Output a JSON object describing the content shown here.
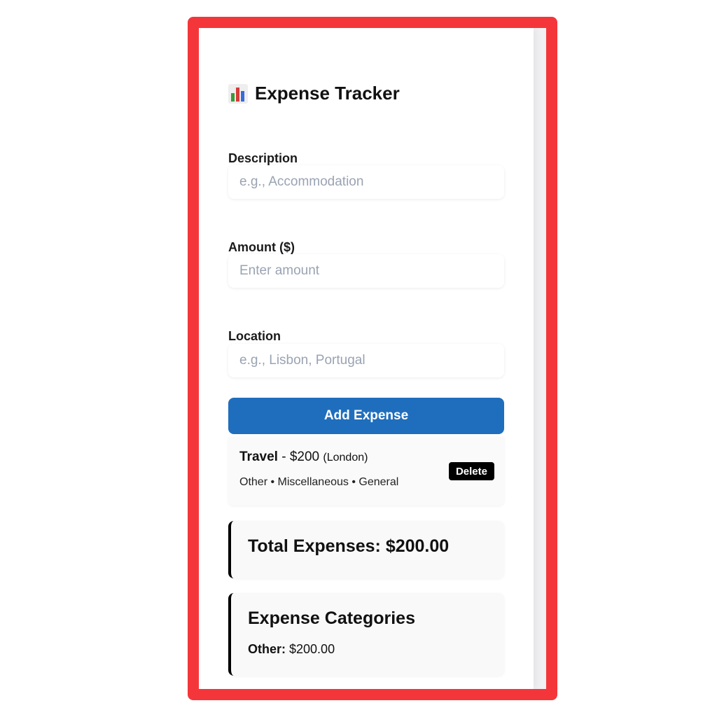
{
  "app": {
    "title": "Expense Tracker",
    "title_icon": "bar-chart-icon"
  },
  "form": {
    "description": {
      "label": "Description",
      "placeholder": "e.g., Accommodation",
      "value": ""
    },
    "amount": {
      "label": "Amount ($)",
      "placeholder": "Enter amount",
      "value": ""
    },
    "location": {
      "label": "Location",
      "placeholder": "e.g., Lisbon, Portugal",
      "value": ""
    },
    "submit_label": "Add Expense"
  },
  "expenses": [
    {
      "name": "Travel",
      "separator": " - ",
      "amount": "$200",
      "location": "(London)",
      "tags": "Other • Miscellaneous • General",
      "delete_label": "Delete"
    }
  ],
  "summary": {
    "total_label": "Total Expenses: $200.00",
    "categories_title": "Expense Categories",
    "categories": [
      {
        "name": "Other:",
        "amount": "$200.00"
      }
    ]
  },
  "colors": {
    "primary_button": "#1f6ebd",
    "delete_button": "#000000",
    "frame_border": "#f4363b",
    "accent_border": "#000000"
  }
}
